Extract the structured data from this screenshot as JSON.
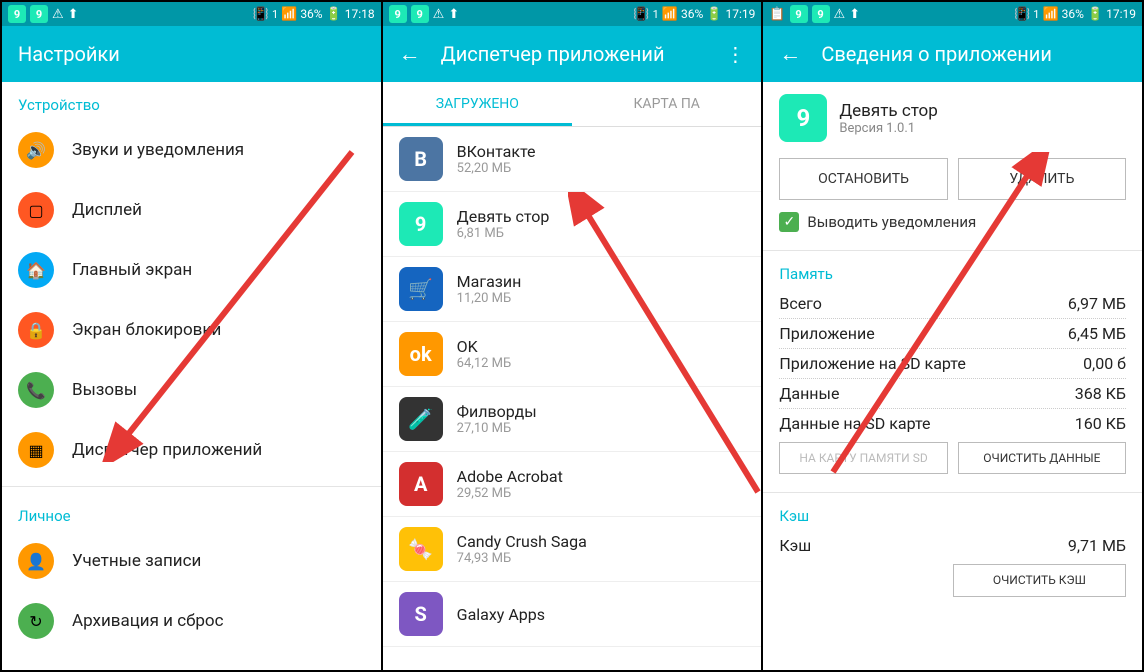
{
  "statusbar": {
    "battery": "36%",
    "time1": "17:18",
    "time2": "17:19",
    "sim": "1"
  },
  "screen1": {
    "title": "Настройки",
    "section_device": "Устройство",
    "section_personal": "Личное",
    "items": {
      "sounds": "Звуки и уведомления",
      "display": "Дисплей",
      "home": "Главный экран",
      "lock": "Экран блокировки",
      "calls": "Вызовы",
      "appmgr": "Диспетчер приложений",
      "accounts": "Учетные записи",
      "backup": "Архивация и сброс"
    }
  },
  "screen2": {
    "title": "Диспетчер приложений",
    "tabs": {
      "downloaded": "ЗАГРУЖЕНО",
      "sdcard": "КАРТА ПА"
    },
    "apps": [
      {
        "name": "ВКонтакте",
        "size": "52,20 МБ"
      },
      {
        "name": "Девять стор",
        "size": "6,81 МБ"
      },
      {
        "name": "Магазин",
        "size": "11,20 МБ"
      },
      {
        "name": "OK",
        "size": "64,12 МБ"
      },
      {
        "name": "Филворды",
        "size": "27,10 МБ"
      },
      {
        "name": "Adobe Acrobat",
        "size": "29,52 МБ"
      },
      {
        "name": "Candy Crush Saga",
        "size": "74,93 МБ"
      },
      {
        "name": "Galaxy Apps",
        "size": ""
      }
    ]
  },
  "screen3": {
    "title": "Сведения о приложении",
    "app_name": "Девять стор",
    "app_version": "Версия 1.0.1",
    "btn_stop": "ОСТАНОВИТЬ",
    "btn_delete": "УДАЛИТЬ",
    "chk_notify": "Выводить уведомления",
    "mem_header": "Память",
    "rows": {
      "total_l": "Всего",
      "total_v": "6,97 МБ",
      "app_l": "Приложение",
      "app_v": "6,45 МБ",
      "appsd_l": "Приложение на SD карте",
      "appsd_v": "0,00 б",
      "data_l": "Данные",
      "data_v": "368 КБ",
      "datasd_l": "Данные на SD карте",
      "datasd_v": "160 КБ"
    },
    "btn_tosd": "НА КАРТУ ПАМЯТИ SD",
    "btn_cleardata": "ОЧИСТИТЬ ДАННЫЕ",
    "cache_header": "Кэш",
    "cache_l": "Кэш",
    "cache_v": "9,71 МБ",
    "btn_clearcache": "ОЧИСТИТЬ КЭШ"
  }
}
